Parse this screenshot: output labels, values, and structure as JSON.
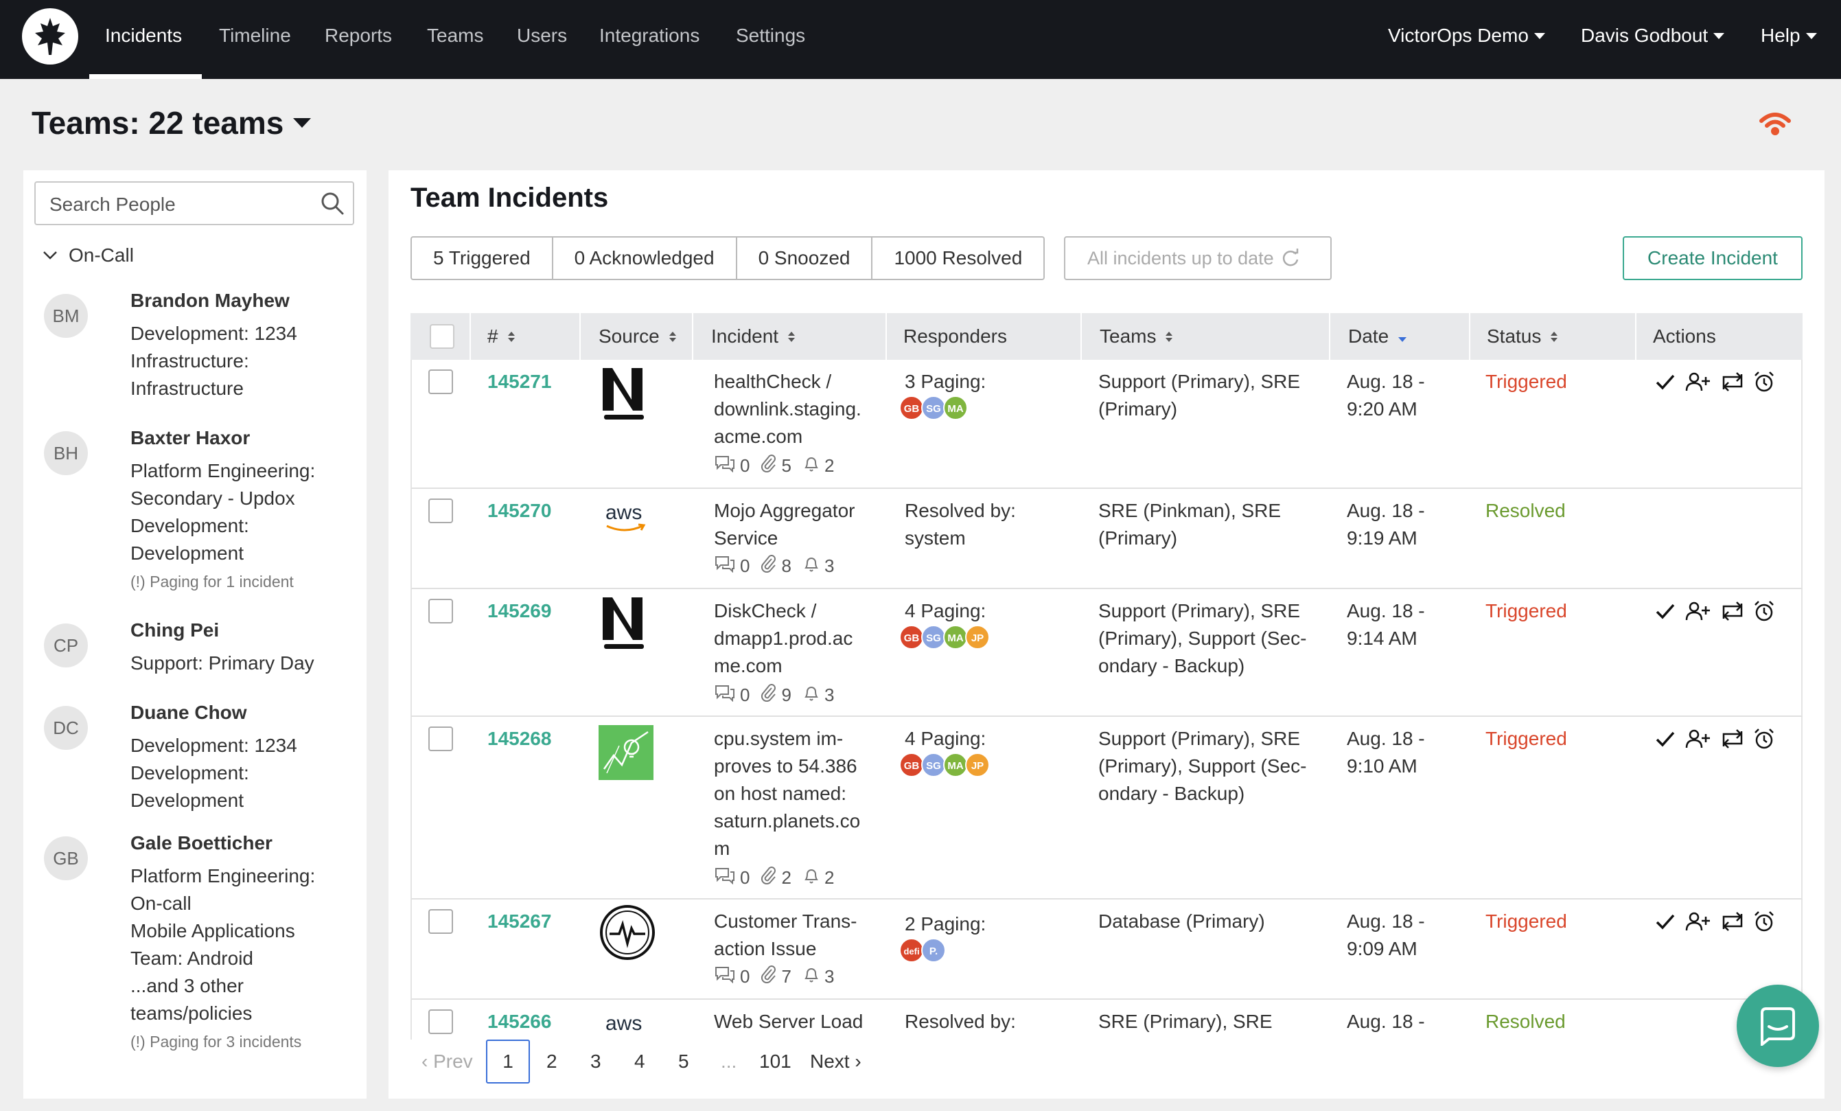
{
  "nav": {
    "items": [
      "Incidents",
      "Timeline",
      "Reports",
      "Teams",
      "Users",
      "Integrations",
      "Settings"
    ],
    "org": "VictorOps Demo",
    "user": "Davis Godbout",
    "help": "Help"
  },
  "page_title": "Teams: 22 teams",
  "sidebar": {
    "search_placeholder": "Search People",
    "section": "On-Call",
    "people": [
      {
        "initials": "BM",
        "name": "Brandon Mayhew",
        "lines": [
          "Development: 1234",
          "Infrastructure:",
          "Infrastructure"
        ],
        "note": ""
      },
      {
        "initials": "BH",
        "name": "Baxter Haxor",
        "lines": [
          "Platform Engineering:",
          "Secondary - Updox",
          "Development:",
          "Development"
        ],
        "note": "(!) Paging for 1 incident"
      },
      {
        "initials": "CP",
        "name": "Ching Pei",
        "lines": [
          "Support: Primary Day"
        ],
        "note": ""
      },
      {
        "initials": "DC",
        "name": "Duane Chow",
        "lines": [
          "Development: 1234",
          "Development:",
          "Development"
        ],
        "note": ""
      },
      {
        "initials": "GB",
        "name": "Gale Boetticher",
        "lines": [
          "Platform Engineering:",
          "On-call",
          "Mobile Applications",
          "Team: Android",
          "...and 3 other",
          "teams/policies"
        ],
        "note": "(!) Paging for 3 incidents"
      }
    ]
  },
  "main": {
    "title": "Team Incidents",
    "filters": [
      "5 Triggered",
      "0 Acknowledged",
      "0 Snoozed",
      "1000 Resolved"
    ],
    "uptodate": "All incidents up to date",
    "create_label": "Create Incident",
    "columns": [
      "#",
      "Source",
      "Incident",
      "Responders",
      "Teams",
      "Date",
      "Status",
      "Actions"
    ],
    "rows": [
      {
        "id": "145271",
        "source": "newrelic",
        "incident": [
          "healthCheck /",
          "downlink.staging.",
          "acme.com"
        ],
        "counts": [
          "0",
          "5",
          "2"
        ],
        "responders": "3 Paging:",
        "bubbles": [
          "GB",
          "SG",
          "MA"
        ],
        "teams": [
          "Support (Primary), SRE",
          "(Primary)"
        ],
        "date": [
          "Aug. 18 -",
          "9:20 AM"
        ],
        "status": "Triggered",
        "actions": true
      },
      {
        "id": "145270",
        "source": "aws",
        "incident": [
          "Mojo Aggregator",
          "Service"
        ],
        "counts": [
          "0",
          "8",
          "3"
        ],
        "responders": "Resolved by:\nsystem",
        "bubbles": [],
        "teams": [
          "SRE (Pinkman), SRE",
          "(Primary)"
        ],
        "date": [
          "Aug. 18 -",
          "9:19 AM"
        ],
        "status": "Resolved",
        "actions": false
      },
      {
        "id": "145269",
        "source": "newrelic",
        "incident": [
          "DiskCheck /",
          "dmapp1.prod.ac",
          "me.com"
        ],
        "counts": [
          "0",
          "9",
          "3"
        ],
        "responders": "4 Paging:",
        "bubbles": [
          "GB",
          "SG",
          "MA",
          "JP"
        ],
        "teams": [
          "Support (Primary), SRE",
          "(Primary), Support (Sec-",
          "ondary - Backup)"
        ],
        "date": [
          "Aug. 18 -",
          "9:14 AM"
        ],
        "status": "Triggered",
        "actions": true
      },
      {
        "id": "145268",
        "source": "graph",
        "incident": [
          "cpu.system im-",
          "proves to 54.386",
          "on host named:",
          "saturn.planets.co",
          "m"
        ],
        "counts": [
          "0",
          "2",
          "2"
        ],
        "responders": "4 Paging:",
        "bubbles": [
          "GB",
          "SG",
          "MA",
          "JP"
        ],
        "teams": [
          "Support (Primary), SRE",
          "(Primary), Support (Sec-",
          "ondary - Backup)"
        ],
        "date": [
          "Aug. 18 -",
          "9:10 AM"
        ],
        "status": "Triggered",
        "actions": true
      },
      {
        "id": "145267",
        "source": "pulse",
        "incident": [
          "Customer Trans-",
          "action Issue"
        ],
        "counts": [
          "0",
          "7",
          "3"
        ],
        "responders": "2 Paging:",
        "bubbles": [
          "defi",
          "P."
        ],
        "teams": [
          "Database (Primary)"
        ],
        "date": [
          "Aug. 18 -",
          "9:09 AM"
        ],
        "status": "Triggered",
        "actions": true
      },
      {
        "id": "145266",
        "source": "aws",
        "incident": [
          "Web Server Load"
        ],
        "counts": [],
        "responders": "Resolved by:",
        "bubbles": [],
        "teams": [
          "SRE (Primary), SRE"
        ],
        "date": [
          "Aug. 18 -"
        ],
        "status": "Resolved",
        "actions": false
      }
    ],
    "pager": {
      "prev": "Prev",
      "pages": [
        "1",
        "2",
        "3",
        "4",
        "5",
        "...",
        "101"
      ],
      "next": "Next"
    }
  },
  "colors": {
    "accent": "#3aa990",
    "triggered": "#d9452a",
    "resolved": "#6a9a2e",
    "nav_bg": "#16181d"
  }
}
